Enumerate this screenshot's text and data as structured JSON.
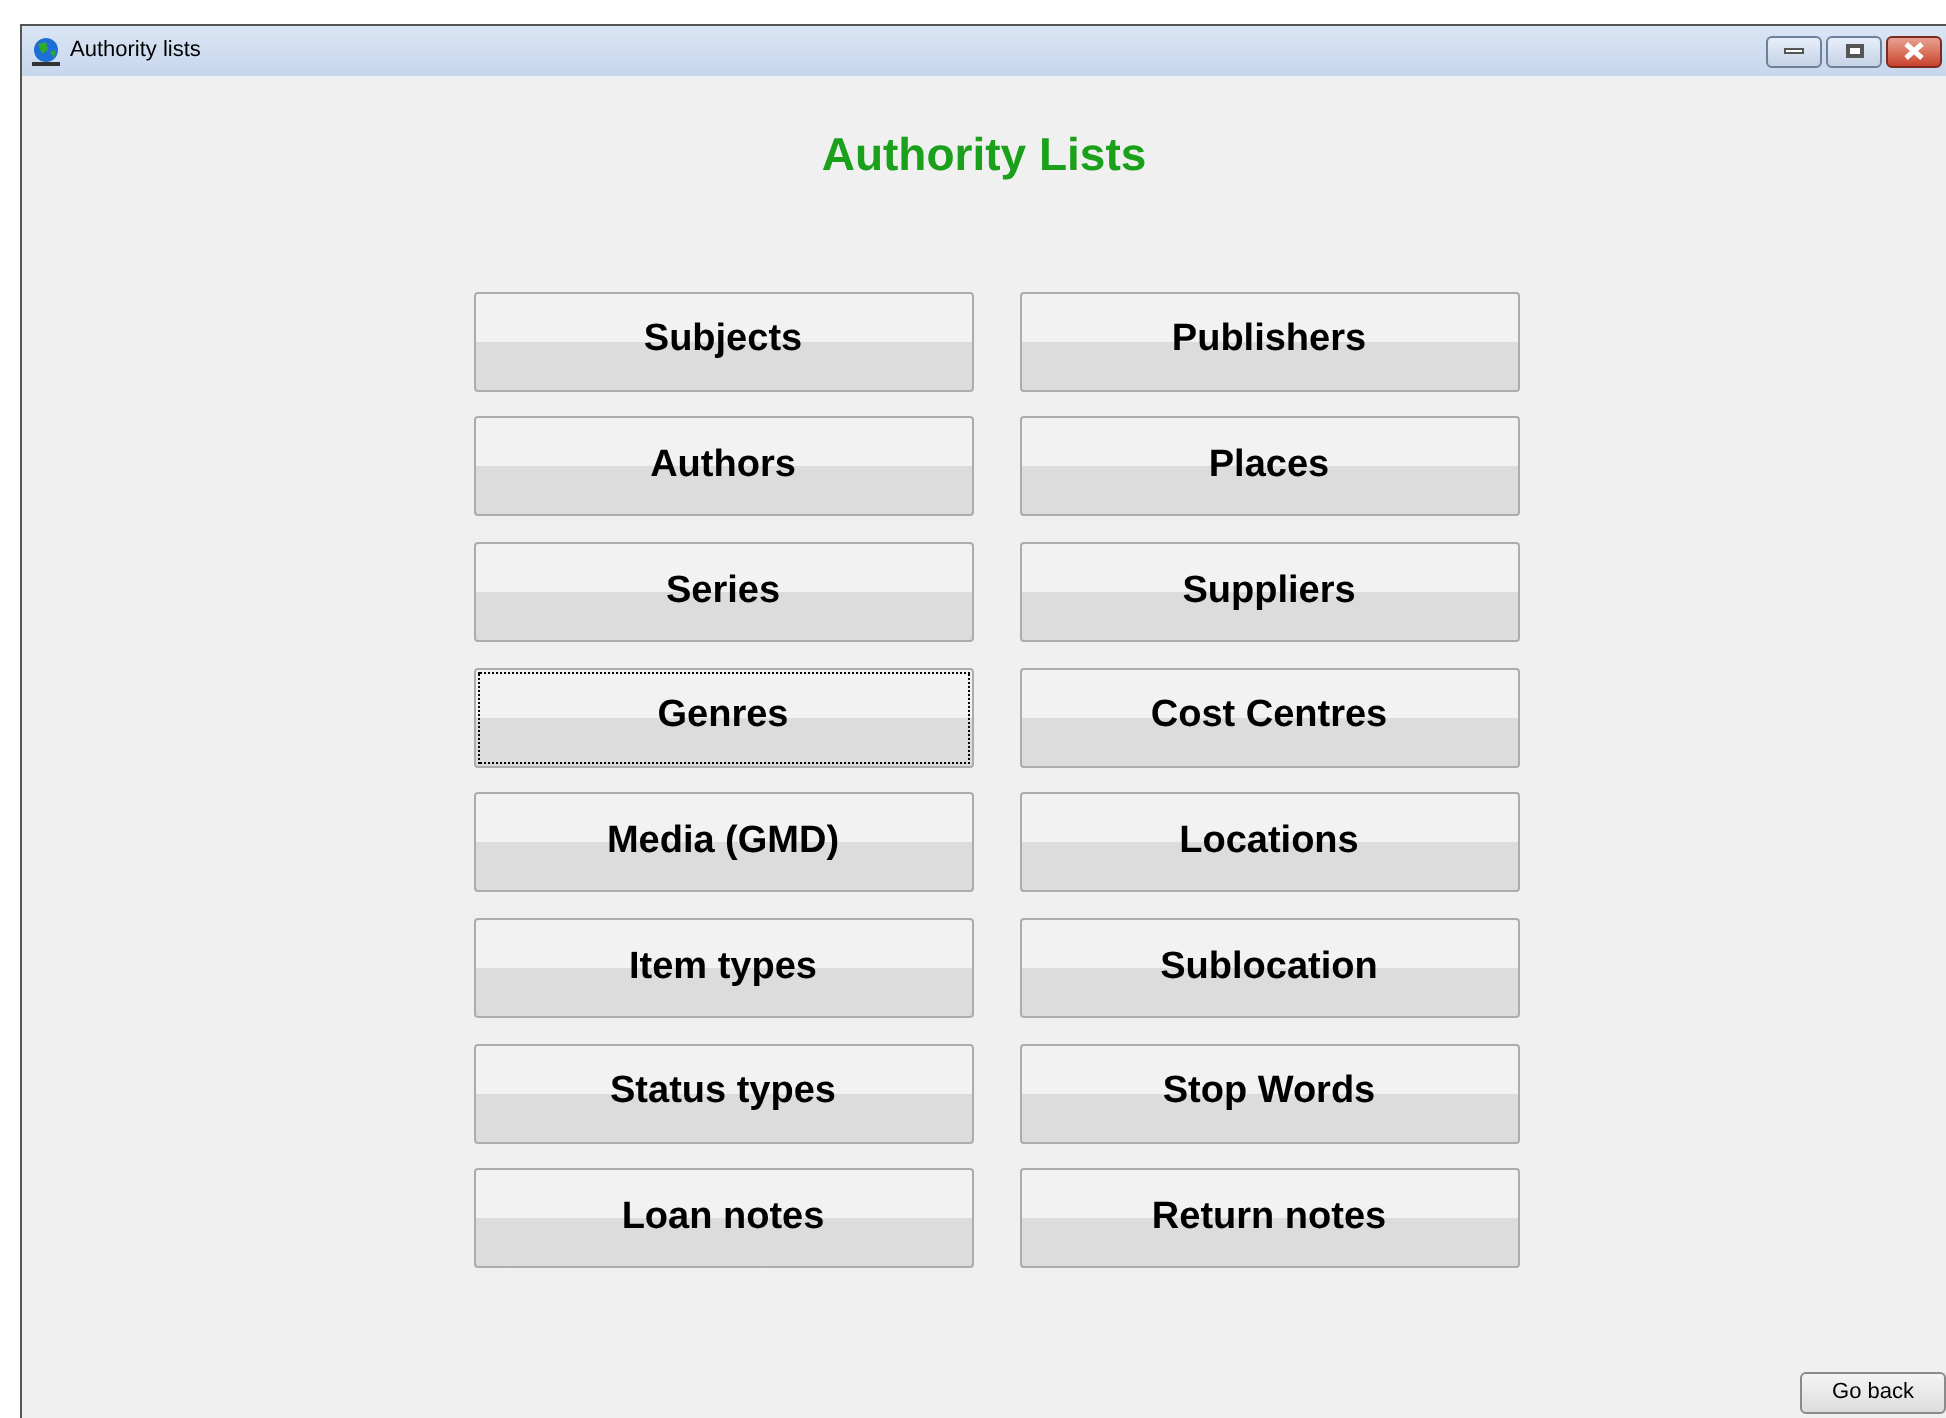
{
  "window": {
    "title": "Authority lists"
  },
  "heading": "Authority Lists",
  "left_buttons": [
    {
      "label": "Subjects",
      "focused": false
    },
    {
      "label": "Authors",
      "focused": false
    },
    {
      "label": "Series",
      "focused": false
    },
    {
      "label": "Genres",
      "focused": true
    },
    {
      "label": "Media (GMD)",
      "focused": false
    },
    {
      "label": "Item types",
      "focused": false
    },
    {
      "label": "Status types",
      "focused": false
    },
    {
      "label": "Loan notes",
      "focused": false
    }
  ],
  "right_buttons": [
    {
      "label": "Publishers",
      "focused": false
    },
    {
      "label": "Places",
      "focused": false
    },
    {
      "label": "Suppliers",
      "focused": false
    },
    {
      "label": "Cost Centres",
      "focused": false
    },
    {
      "label": "Locations",
      "focused": false
    },
    {
      "label": "Sublocation",
      "focused": false
    },
    {
      "label": "Stop Words",
      "focused": false
    },
    {
      "label": "Return notes",
      "focused": false
    }
  ],
  "go_back": "Go back"
}
